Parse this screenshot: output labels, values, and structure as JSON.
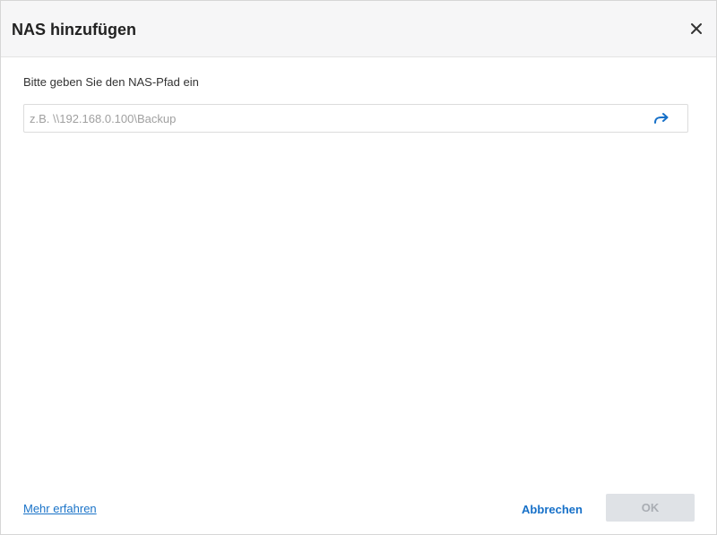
{
  "dialog": {
    "title": "NAS hinzufügen",
    "close_icon": "close-icon"
  },
  "form": {
    "prompt": "Bitte geben Sie den NAS-Pfad ein",
    "path_value": "",
    "path_placeholder": "z.B. \\\\192.168.0.100\\Backup",
    "go_icon": "arrow-right-icon"
  },
  "footer": {
    "learn_more": "Mehr erfahren",
    "cancel_label": "Abbrechen",
    "ok_label": "OK",
    "ok_enabled": false
  },
  "colors": {
    "accent": "#1670c8",
    "header_bg": "#f6f6f7",
    "disabled_bg": "#dfe2e6",
    "disabled_text": "#a9adb3"
  }
}
